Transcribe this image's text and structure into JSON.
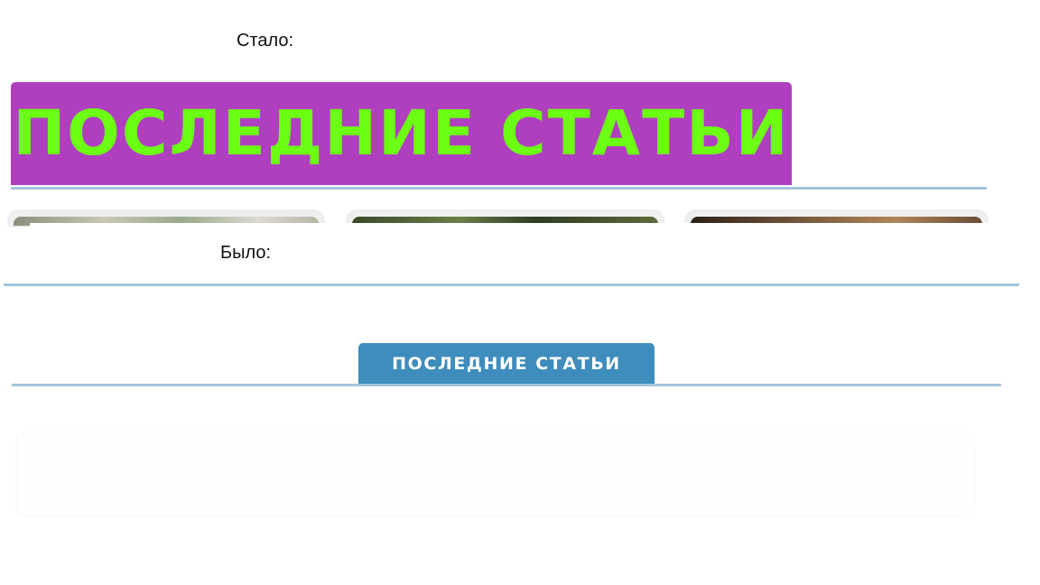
{
  "after_section": {
    "label": "Стало:",
    "banner_text": "ПОСЛЕДНИЕ СТАТЬИ",
    "colors": {
      "banner_bg": "#b03fc0",
      "banner_text": "#6cff14",
      "rule": "#a3c5da"
    }
  },
  "before_section": {
    "label": "Было:",
    "tab_text": "ПОСЛЕДНИЕ СТАТЬИ",
    "colors": {
      "tab_bg": "#3e8dbd",
      "tab_text": "#ffffff",
      "rule": "#a3c5da"
    }
  }
}
